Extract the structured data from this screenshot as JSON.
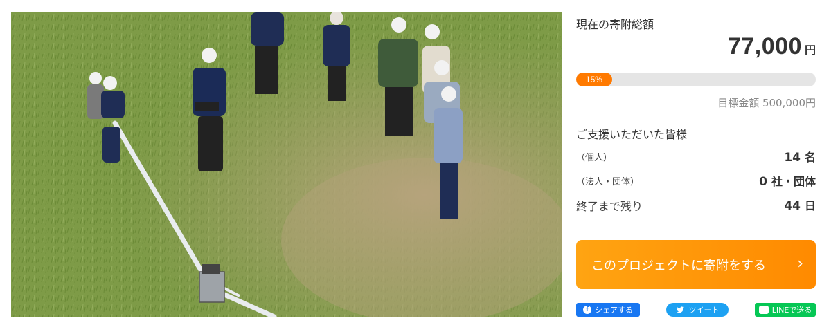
{
  "photo": {
    "alt_icon": "project-photo"
  },
  "funding": {
    "label": "現在の寄附総額",
    "amount": "77,000",
    "unit": "円",
    "progress_label": "15%",
    "progress_fraction": 0.15,
    "goal": "目標金額 500,000円"
  },
  "supporters": {
    "title": "ご支援いただいた皆様",
    "individual_label": "（個人）",
    "individual_value": "14",
    "individual_unit": "名",
    "corporate_label": "（法人・団体）",
    "corporate_value": "0",
    "corporate_unit": "社・団体",
    "remaining_label": "終了まで残り",
    "remaining_value": "44",
    "remaining_unit": "日"
  },
  "donate_button": {
    "label": "このプロジェクトに寄附をする",
    "chevron": "›"
  },
  "share": {
    "facebook": "シェアする",
    "twitter": "ツイート",
    "line": "LINEで送る",
    "facebook_icon": "facebook-icon",
    "twitter_icon": "twitter-icon",
    "line_icon": "line-icon"
  },
  "colors": {
    "accent": "#ff8a00",
    "progress_track": "#e5e5e5",
    "facebook": "#1877f2",
    "twitter": "#1da1f2",
    "line": "#06c755"
  }
}
